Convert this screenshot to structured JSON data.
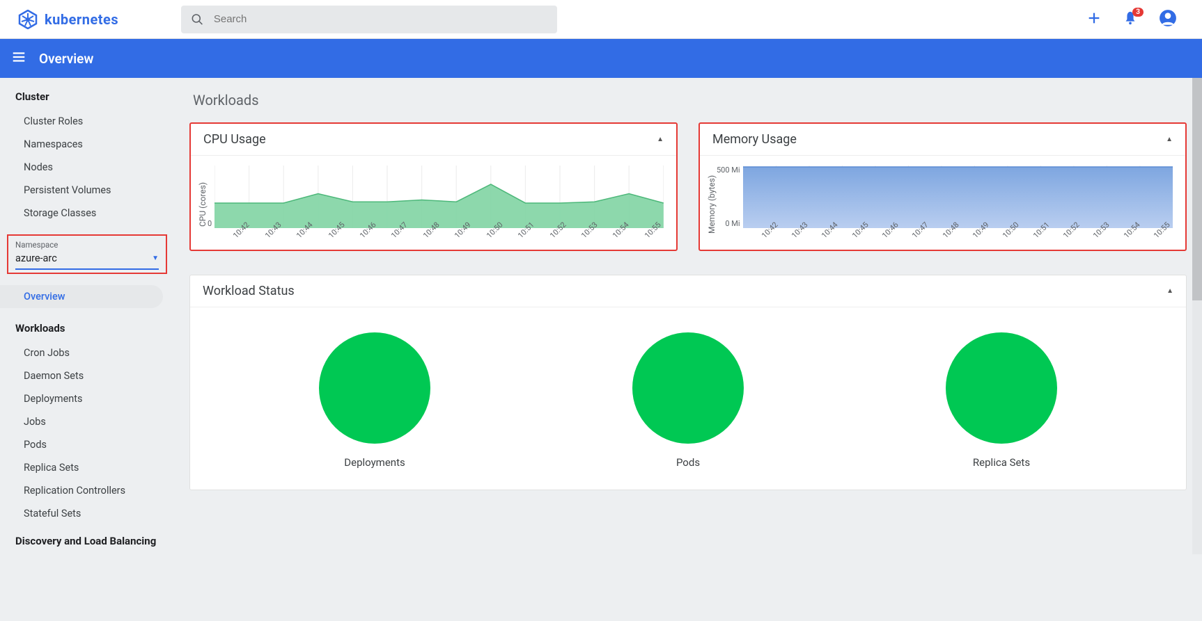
{
  "header": {
    "brand": "kubernetes",
    "search_placeholder": "Search",
    "notification_count": "3"
  },
  "bluebar": {
    "title": "Overview"
  },
  "sidebar": {
    "cluster_section": "Cluster",
    "cluster_items": [
      "Cluster Roles",
      "Namespaces",
      "Nodes",
      "Persistent Volumes",
      "Storage Classes"
    ],
    "ns_label": "Namespace",
    "ns_value": "azure-arc",
    "overview": "Overview",
    "workloads_section": "Workloads",
    "workloads_items": [
      "Cron Jobs",
      "Daemon Sets",
      "Deployments",
      "Jobs",
      "Pods",
      "Replica Sets",
      "Replication Controllers",
      "Stateful Sets"
    ],
    "dlb_section": "Discovery and Load Balancing"
  },
  "main": {
    "page_title": "Workloads",
    "cpu_card_title": "CPU Usage",
    "mem_card_title": "Memory Usage",
    "status_card_title": "Workload Status",
    "status_items": [
      "Deployments",
      "Pods",
      "Replica Sets"
    ]
  },
  "chart_data": [
    {
      "type": "area",
      "title": "CPU Usage",
      "ylabel": "CPU (cores)",
      "yticks": [
        "0"
      ],
      "x": [
        "10:42",
        "10:43",
        "10:44",
        "10:45",
        "10:46",
        "10:47",
        "10:48",
        "10:49",
        "10:50",
        "10:51",
        "10:52",
        "10:53",
        "10:54",
        "10:55"
      ],
      "series": [
        {
          "name": "cpu",
          "values": [
            0.4,
            0.4,
            0.4,
            0.55,
            0.42,
            0.42,
            0.45,
            0.42,
            0.7,
            0.4,
            0.4,
            0.42,
            0.55,
            0.4
          ]
        }
      ],
      "ylim": [
        0,
        1
      ]
    },
    {
      "type": "area",
      "title": "Memory Usage",
      "ylabel": "Memory (bytes)",
      "yticks": [
        "500 Mi",
        "0 Mi"
      ],
      "x": [
        "10:42",
        "10:43",
        "10:44",
        "10:45",
        "10:46",
        "10:47",
        "10:48",
        "10:49",
        "10:50",
        "10:51",
        "10:52",
        "10:53",
        "10:54",
        "10:55"
      ],
      "series": [
        {
          "name": "memory",
          "values": [
            500,
            500,
            500,
            500,
            500,
            500,
            500,
            500,
            500,
            500,
            500,
            500,
            500,
            500
          ]
        }
      ],
      "ylim": [
        0,
        500
      ]
    }
  ]
}
